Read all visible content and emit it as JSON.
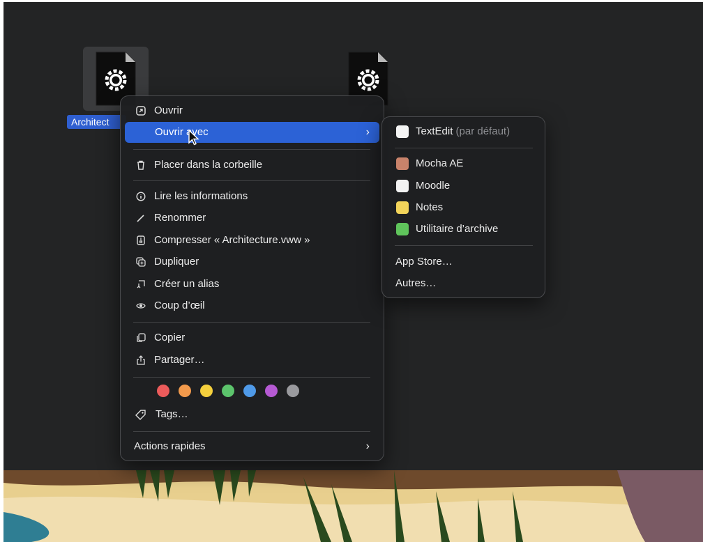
{
  "desktop": {
    "file_label": "Architect"
  },
  "context_menu": {
    "items": [
      {
        "label": "Ouvrir",
        "icon": "open-icon"
      },
      {
        "label": "Ouvrir avec",
        "highlighted": true
      },
      {
        "label": "Placer dans la corbeille",
        "icon": "trash-icon"
      },
      {
        "label": "Lire les informations",
        "icon": "info-icon"
      },
      {
        "label": "Renommer",
        "icon": "pencil-icon"
      },
      {
        "label": "Compresser « Architecture.vww »",
        "icon": "archive-icon"
      },
      {
        "label": "Dupliquer",
        "icon": "duplicate-icon"
      },
      {
        "label": "Créer un alias",
        "icon": "alias-icon"
      },
      {
        "label": "Coup d’œil",
        "icon": "eye-icon"
      },
      {
        "label": "Copier",
        "icon": "copy-icon"
      },
      {
        "label": "Partager…",
        "icon": "share-icon"
      },
      {
        "label": "Tags…",
        "icon": "tag-icon"
      },
      {
        "label": "Actions rapides"
      }
    ],
    "chevron": "›",
    "tag_colors": [
      "#ec5b5b",
      "#f29a4c",
      "#f5d03d",
      "#5cc46c",
      "#4f9ae8",
      "#b65ad4",
      "#9a9a9e"
    ]
  },
  "submenu": {
    "default_app": "TextEdit",
    "default_suffix": "(par défaut)",
    "apps": [
      {
        "label": "Mocha AE",
        "color": "#c9836b"
      },
      {
        "label": "Moodle",
        "color": "#f2f2f2"
      },
      {
        "label": "Notes",
        "color": "#f3d45a"
      },
      {
        "label": "Utilitaire d’archive",
        "color": "#5fc45b"
      }
    ],
    "app_store": "App Store…",
    "others": "Autres…"
  }
}
